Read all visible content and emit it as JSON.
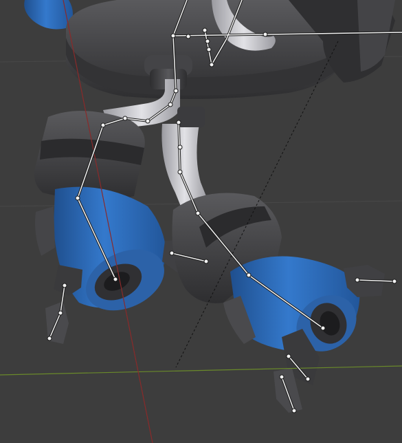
{
  "viewport": {
    "name": "3D Viewport",
    "background": "#3d3d3d",
    "x_axis_color": "#6a8a2a",
    "y_axis_color": "#8a2a2a"
  },
  "colors": {
    "dark_part": "#3a3a3c",
    "dark_part_light": "#58585b",
    "blue_part": "#2f6fc0",
    "blue_part_dark": "#20508f",
    "white_pipe": "#c8c8cc",
    "bone": "#ffffff",
    "bone_outline": "#1a1a1a"
  },
  "objects": [
    {
      "name": "robot-body",
      "type": "mesh"
    },
    {
      "name": "left-gripper",
      "type": "mesh"
    },
    {
      "name": "right-gripper",
      "type": "mesh"
    },
    {
      "name": "armature",
      "type": "armature"
    }
  ]
}
